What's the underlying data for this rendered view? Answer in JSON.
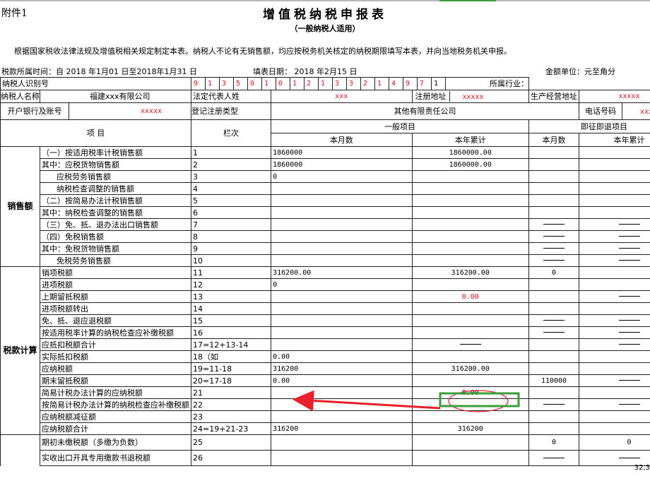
{
  "annex_label": "附件1",
  "title": "增值税纳税申报表",
  "subtitle": "（一般纳税人适用）",
  "intro": "根据国家税收法律法规及增值税相关规定制定本表。纳税人不论有无销售额，均应按税务机关核定的纳税期限填写本表，并向当地税务机关申报。",
  "period_label": "税款所属时间：自 2018 年1月01 日至2018年1月31 日",
  "fill_date_label": "填表日期：  2018 年2月15  日",
  "unit_label": "金额单位：元至角分",
  "taxpayer_id_label": "纳税人识别号",
  "taxpayer_id_digits": [
    "9",
    "1",
    "3",
    "5",
    "0",
    "1",
    "0",
    "1",
    "2",
    "1",
    "3",
    "3",
    "2",
    "1",
    "4",
    "9",
    "7",
    "1"
  ],
  "industry_label": "所属行业：",
  "taxpayer_name_label": "纳税人名称",
  "taxpayer_name": "福建xxx有限公司",
  "legal_rep_label": "法定代表人姓",
  "legal_rep": "xxx",
  "reg_address_label": "注册地址",
  "reg_address": "xxxxx",
  "biz_address_label": "生产经营地址",
  "biz_address": "xxxxx",
  "bank_label": "开户银行及账号",
  "bank_value": "xxxxx",
  "reg_type_label": "登记注册类型",
  "reg_type": "其他有限责任公司",
  "phone_label": "电话号码",
  "phone": "xxxxx",
  "headers": {
    "item": "项     目",
    "col_no": "栏次",
    "general": "一般项目",
    "immediate": "即征即退项目",
    "month": "本月数",
    "year": "本年累计"
  },
  "sections": {
    "sales": "销售额",
    "calc": "税款计算"
  },
  "rows": [
    {
      "item": "（一）按适用税率计税销售额",
      "no": "1",
      "g_month": "1860000",
      "g_year": "1860000.00",
      "i_month": "",
      "i_year": ""
    },
    {
      "item": "其中：应税货物销售额",
      "no": "2",
      "g_month": "1860000",
      "g_year": "1860000.00",
      "i_month": "",
      "i_year": ""
    },
    {
      "item": "      应税劳务销售额",
      "no": "3",
      "g_month": "0",
      "g_year": "",
      "i_month": "",
      "i_year": ""
    },
    {
      "item": "      纳税检查调整的销售额",
      "no": "4",
      "g_month": "",
      "g_year": "",
      "i_month": "",
      "i_year": ""
    },
    {
      "item": "（二）按简易办法计税销售额",
      "no": "5",
      "g_month": "",
      "g_year": "",
      "i_month": "",
      "i_year": ""
    },
    {
      "item": "其中：纳税检查调整的销售额",
      "no": "6",
      "g_month": "",
      "g_year": "",
      "i_month": "",
      "i_year": ""
    },
    {
      "item": "（三）免、抵、退办法出口销售额",
      "no": "7",
      "g_month": "",
      "g_year": "",
      "i_month": "——",
      "i_year": "——"
    },
    {
      "item": "（四）免税销售额",
      "no": "8",
      "g_month": "",
      "g_year": "",
      "i_month": "——",
      "i_year": "——"
    },
    {
      "item": "其中：免税货物销售额",
      "no": "9",
      "g_month": "",
      "g_year": "",
      "i_month": "——",
      "i_year": "——"
    },
    {
      "item": "      免税劳务销售额",
      "no": "10",
      "g_month": "",
      "g_year": "",
      "i_month": "——",
      "i_year": "——"
    },
    {
      "item": "销项税额",
      "no": "11",
      "g_month": "316200.00",
      "g_year": "316200.00",
      "i_month": "0",
      "i_year": ""
    },
    {
      "item": "进项税额",
      "no": "12",
      "g_month": "0",
      "g_year": "",
      "i_month": "",
      "i_year": ""
    },
    {
      "item": "上期留抵税额",
      "no": "13",
      "g_month": "",
      "g_year": "0.00",
      "i_month": "",
      "i_year": "——"
    },
    {
      "item": "进项税额转出",
      "no": "14",
      "g_month": "",
      "g_year": "",
      "i_month": "",
      "i_year": ""
    },
    {
      "item": "免、抵、退应退税额",
      "no": "15",
      "g_month": "",
      "g_year": "",
      "i_month": "——",
      "i_year": "——"
    },
    {
      "item": "按适用税率计算的纳税检查应补缴税额",
      "no": "16",
      "g_month": "",
      "g_year": "",
      "i_month": "——",
      "i_year": "——"
    },
    {
      "item": "应抵扣税额合计",
      "no": "17=12+13-14",
      "g_month": "",
      "g_year": "——",
      "i_month": "",
      "i_year": "——"
    },
    {
      "item": "实际抵扣税额",
      "no": "18（如",
      "g_month": "0.00",
      "g_year": "",
      "i_month": "",
      "i_year": ""
    },
    {
      "item": "应纳税额",
      "no": "19=11-18",
      "g_month": "316200",
      "g_year": "316200.00",
      "i_month": "",
      "i_year": ""
    },
    {
      "item": "期末留抵税额",
      "no": "20=17-18",
      "g_month": "0.00",
      "g_year": "",
      "i_month": "110000",
      "i_year": "——"
    },
    {
      "item": "简易计税办法计算的应纳税额",
      "no": "21",
      "g_month": "",
      "g_year": "0.00",
      "i_month": "",
      "i_year": ""
    },
    {
      "item": "按简易计税办法计算的纳税检查应补缴税额",
      "no": "22",
      "g_month": "",
      "g_year": "",
      "i_month": "——",
      "i_year": "——"
    },
    {
      "item": "应纳税额减征额",
      "no": "23",
      "g_month": "",
      "g_year": "",
      "i_month": "",
      "i_year": ""
    },
    {
      "item": "应纳税额合计",
      "no": "24=19+21-23",
      "g_month": "316200",
      "g_year": "316200",
      "i_month": "",
      "i_year": ""
    },
    {
      "item": "期初未缴税额（多缴为负数）",
      "no": "25",
      "g_month": "",
      "g_year": "",
      "i_month": "0",
      "i_year": "0"
    },
    {
      "item": "实收出口开具专用缴款书退税额",
      "no": "26",
      "g_month": "",
      "g_year": "",
      "i_month": "——",
      "i_year": "——"
    }
  ],
  "page_number": "32,3",
  "colors": {
    "red": "#e0101a",
    "green": "#3a9e3a",
    "arrow": "#e8202a"
  }
}
